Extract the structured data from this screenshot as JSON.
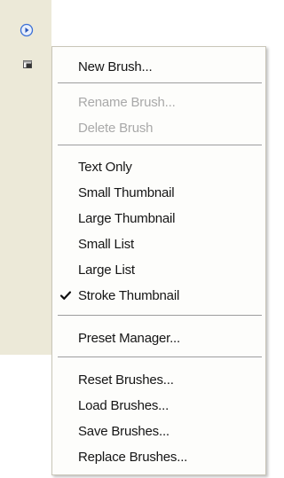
{
  "toolbar": {
    "flyout_icon": "flyout-menu-icon",
    "new_preset_icon": "new-preset-icon",
    "accent": "#3a6fd6"
  },
  "menu": {
    "items": [
      {
        "label": "New Brush...",
        "enabled": true
      },
      {
        "label": "Rename Brush...",
        "enabled": false
      },
      {
        "label": "Delete Brush",
        "enabled": false
      },
      {
        "label": "Text Only",
        "enabled": true
      },
      {
        "label": "Small Thumbnail",
        "enabled": true
      },
      {
        "label": "Large Thumbnail",
        "enabled": true
      },
      {
        "label": "Small List",
        "enabled": true
      },
      {
        "label": "Large List",
        "enabled": true
      },
      {
        "label": "Stroke Thumbnail",
        "enabled": true,
        "checked": true
      },
      {
        "label": "Preset Manager...",
        "enabled": true
      },
      {
        "label": "Reset Brushes...",
        "enabled": true
      },
      {
        "label": "Load Brushes...",
        "enabled": true
      },
      {
        "label": "Save Brushes...",
        "enabled": true
      },
      {
        "label": "Replace Brushes...",
        "enabled": true
      }
    ],
    "check_icon": "checkmark-icon"
  }
}
